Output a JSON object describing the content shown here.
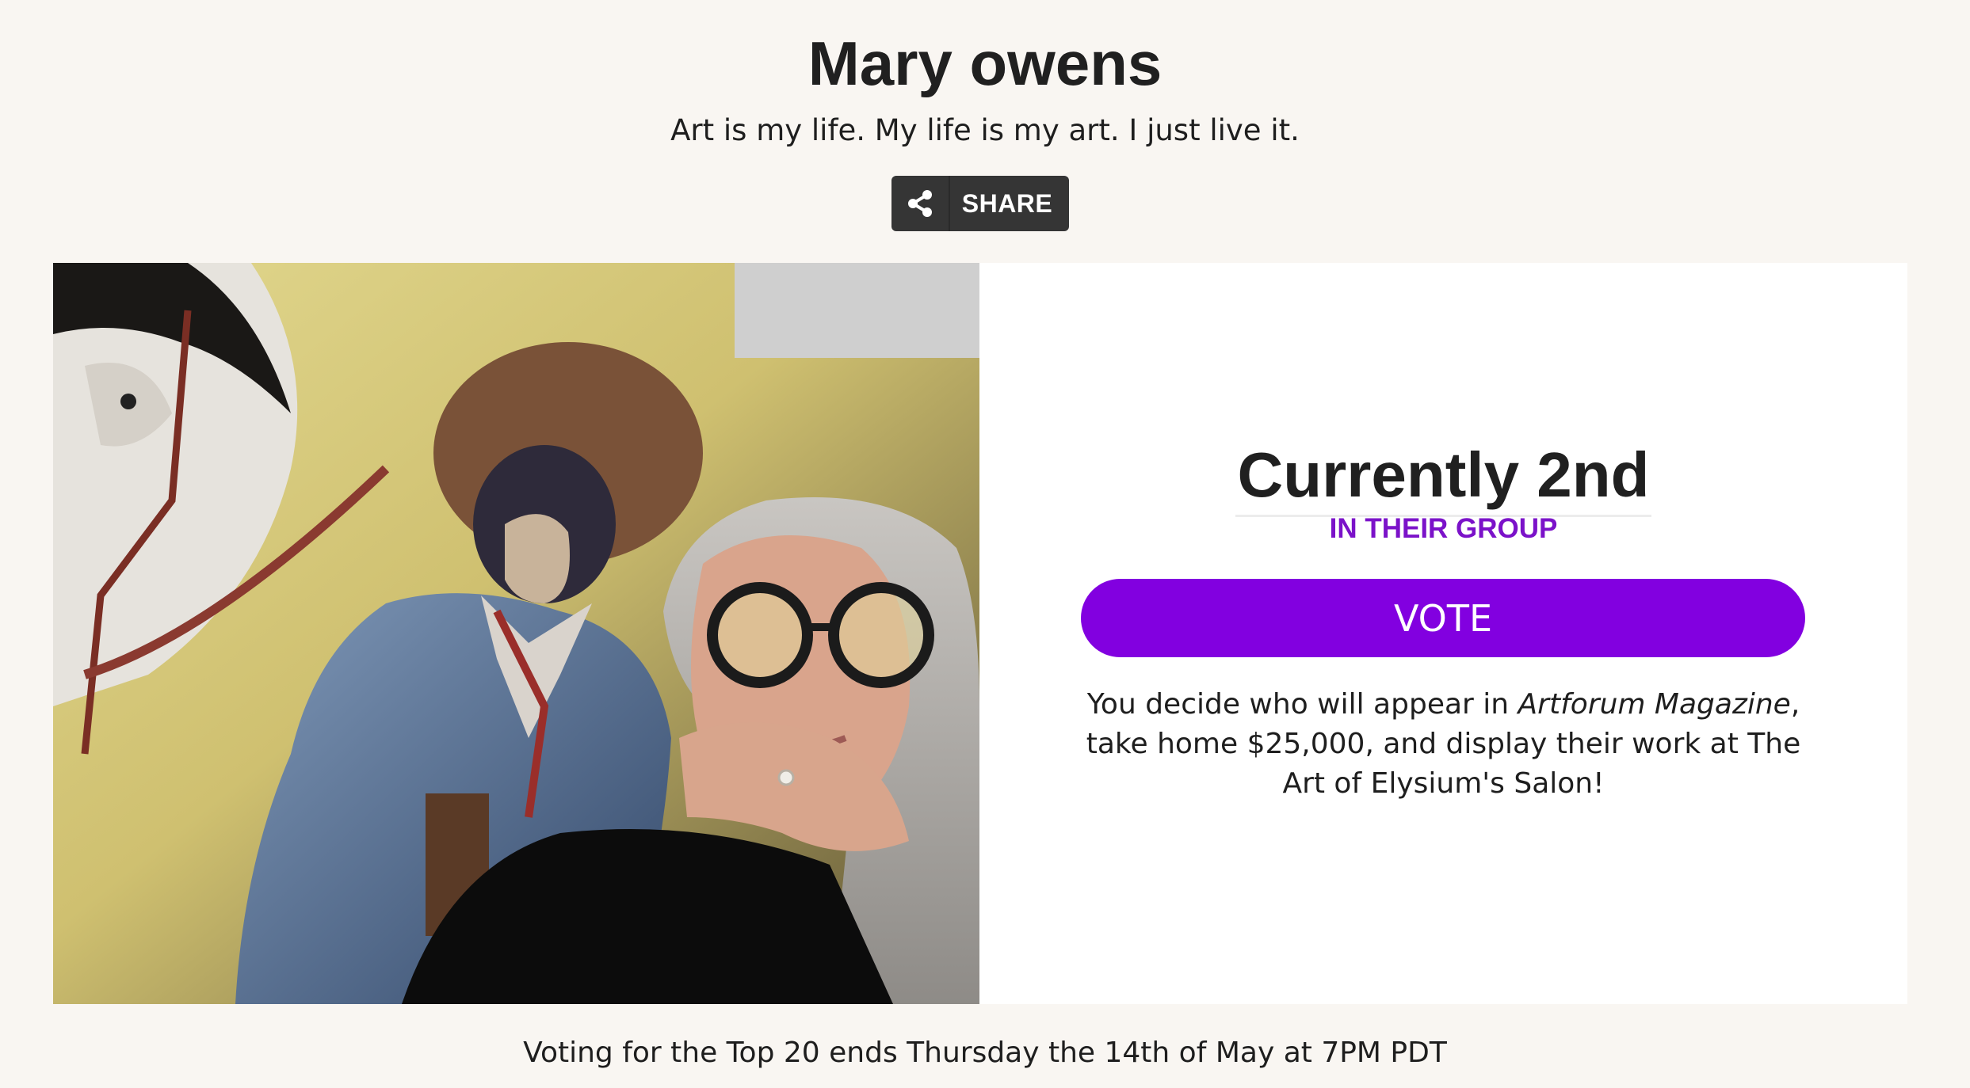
{
  "profile": {
    "name": "Mary owens",
    "tagline": "Art is my life. My life is my art. I just live it."
  },
  "share": {
    "label": "SHARE",
    "icon": "share-icon"
  },
  "photo": {
    "icon": "profile-photo"
  },
  "ranking": {
    "title": "Currently 2nd",
    "subtitle": "IN THEIR GROUP"
  },
  "vote": {
    "label": "VOTE",
    "color": "#8200e0"
  },
  "description": {
    "before": "You decide who will appear in ",
    "magazine": "Artforum Magazine",
    "after": ", take home $25,000, and display their work at The Art of Elysium's Salon!"
  },
  "footer": {
    "text": "Voting for the Top 20 ends Thursday the 14th of May at 7PM PDT"
  },
  "colors": {
    "accent": "#8200e0",
    "subtitle": "#7b12c9",
    "background": "#f9f6f2"
  }
}
